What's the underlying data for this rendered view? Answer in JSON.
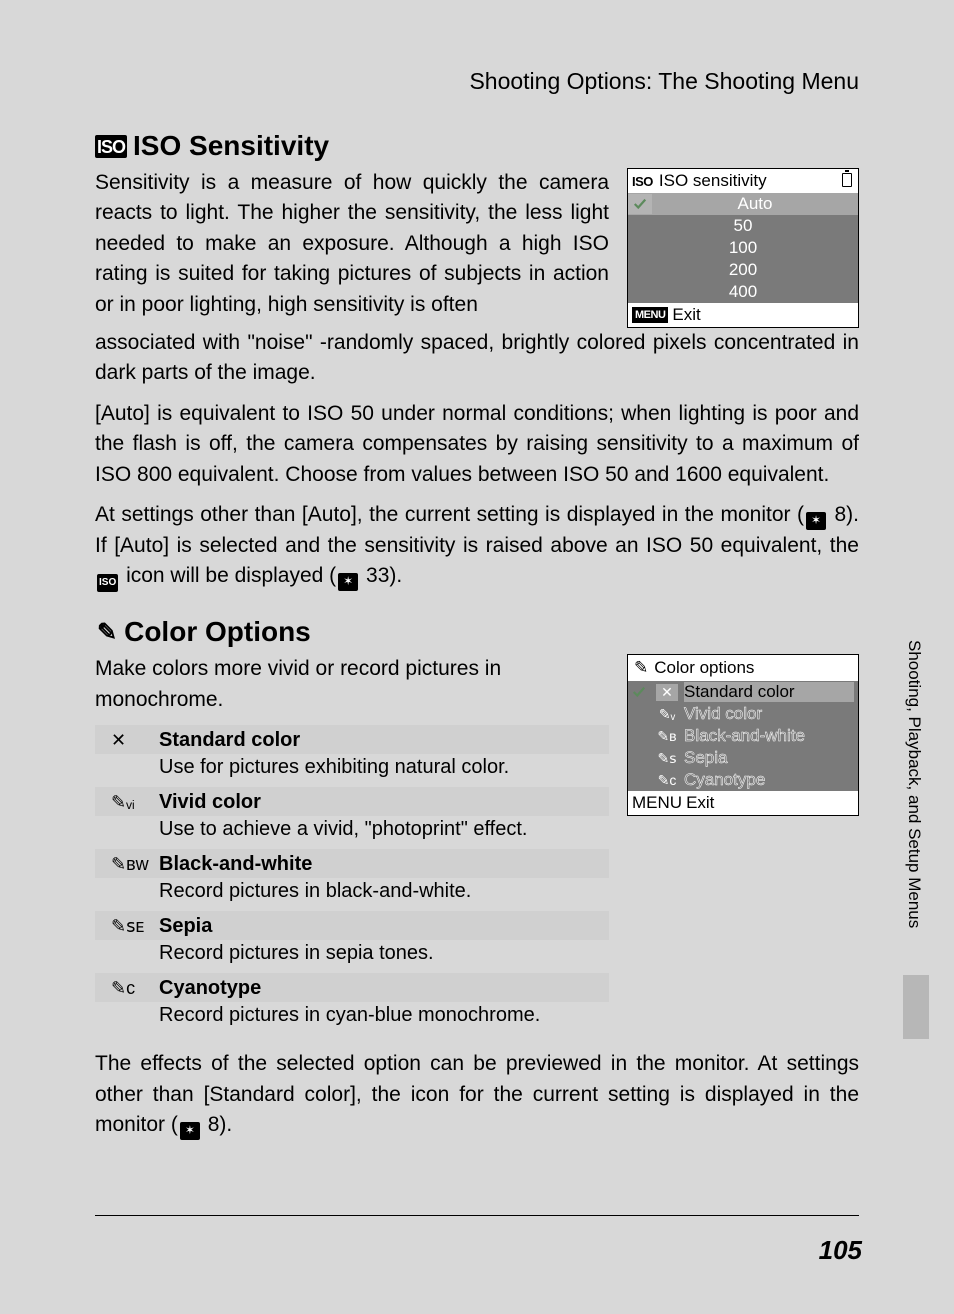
{
  "header": {
    "section_title": "Shooting Options: The Shooting Menu"
  },
  "side_label": "Shooting, Playback, and Setup Menus",
  "page_number": "105",
  "iso": {
    "heading_icon": "ISO",
    "heading": "ISO Sensitivity",
    "p1a": "Sensitivity is a measure of how quickly the camera reacts to light. The higher the sensitivity, the less light needed to make an exposure. Although a high ISO rating is suited for taking pictures of subjects in action or in poor lighting, high sensitivity is often",
    "p1b": "associated with \"noise\" -randomly spaced, brightly colored pixels concentrated in dark parts of the image.",
    "p2": "[Auto] is equivalent to ISO 50 under normal conditions; when lighting is poor and the flash is off, the camera compensates by raising sensitivity to a maximum of ISO 800 equivalent. Choose from values between ISO 50 and 1600 equivalent.",
    "p3_parts": {
      "a": "At settings other than [Auto], the current setting is displayed in the monitor (",
      "ref1": "8",
      "b": "). If [Auto] is selected and the sensitivity is raised above an ISO 50 equivalent, the ",
      "mid_icon": "ISO",
      "c": " icon will be displayed (",
      "ref2": "33",
      "d": ")."
    },
    "lcd": {
      "icon": "ISO",
      "title": "ISO sensitivity",
      "selected": "Auto",
      "rows": [
        "50",
        "100",
        "200",
        "400"
      ],
      "exit": "Exit",
      "menu_tag": "MENU"
    }
  },
  "color": {
    "heading_icon": "✎",
    "heading": "Color Options",
    "p1": "Make colors more vivid or record pictures in monochrome.",
    "options": [
      {
        "icon": "✕",
        "title": "Standard color",
        "desc": "Use for pictures exhibiting natural color."
      },
      {
        "icon": "✎ᵥᵢ",
        "title": "Vivid color",
        "desc": "Use to achieve a vivid, \"photoprint\" effect."
      },
      {
        "icon": "✎ʙᴡ",
        "title": "Black-and-white",
        "desc": "Record pictures in black-and-white."
      },
      {
        "icon": "✎ꜱᴇ",
        "title": "Sepia",
        "desc": "Record pictures in sepia tones."
      },
      {
        "icon": "✎ᴄ",
        "title": "Cyanotype",
        "desc": "Record pictures in cyan-blue monochrome."
      }
    ],
    "p2_parts": {
      "a": "The effects of the selected option can be previewed in the monitor. At settings other than [Standard color], the icon for the current setting is displayed in the monitor (",
      "ref": "8",
      "b": ")."
    },
    "lcd": {
      "icon": "✎",
      "title": "Color options",
      "rows": [
        {
          "icon": "✕",
          "label": "Standard color",
          "selected": true
        },
        {
          "icon": "✎ᵥ",
          "label": "Vivid color"
        },
        {
          "icon": "✎ʙ",
          "label": "Black-and-white"
        },
        {
          "icon": "✎ꜱ",
          "label": "Sepia"
        },
        {
          "icon": "✎ᴄ",
          "label": "Cyanotype"
        }
      ],
      "exit": "Exit",
      "menu_tag": "MENU"
    }
  }
}
